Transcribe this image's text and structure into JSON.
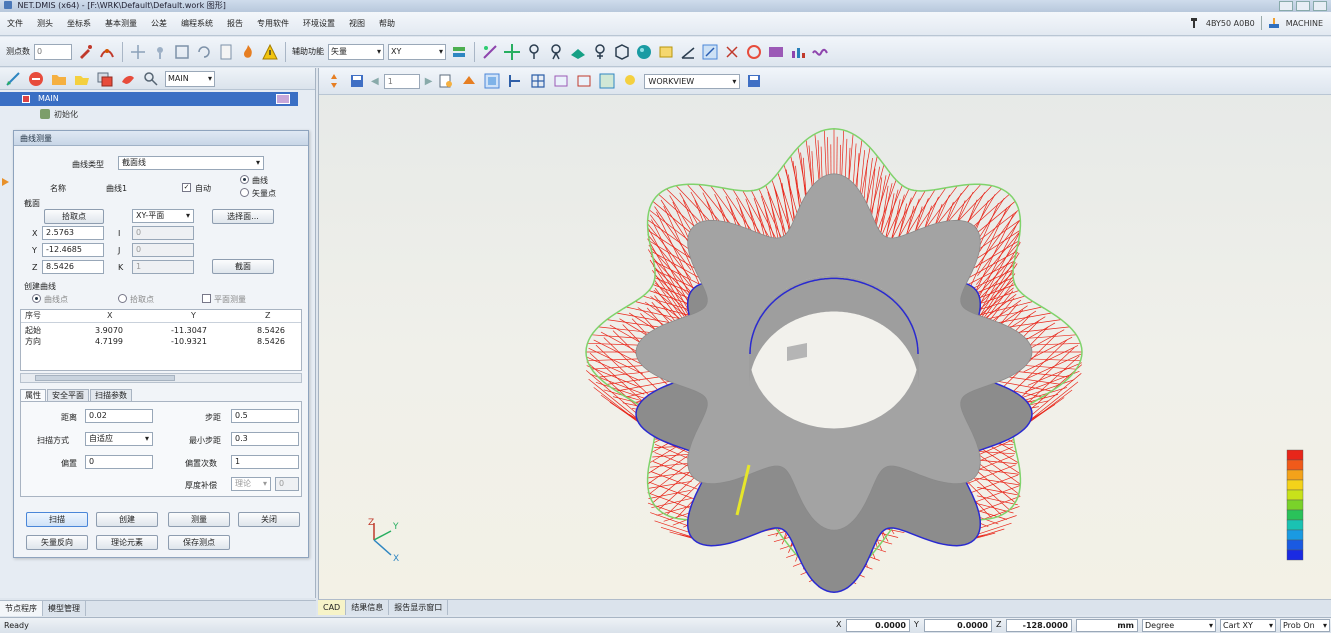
{
  "window": {
    "title": "NET.DMIS (x64) - [F:\\WRK\\Default\\Default.work 图形]"
  },
  "menu": {
    "items": [
      "文件",
      "测头",
      "坐标系",
      "基本测量",
      "公差",
      "编程系统",
      "报告",
      "专用软件",
      "环境设置",
      "视图",
      "帮助"
    ],
    "right_probe": "4BY50  A0B0",
    "right_machine": "MACHINE"
  },
  "toolbar": {
    "probe_label": "测点数",
    "probe_value": "0",
    "aux_label": "辅助功能",
    "aux_value": "矢量",
    "plane_value": "XY"
  },
  "left": {
    "program_combo": "MAIN",
    "tree_main": "MAIN",
    "tree_child": "初始化"
  },
  "dialog": {
    "title": "曲线测量",
    "curve_type_label": "曲线类型",
    "curve_type_value": "截面线",
    "name_label": "名称",
    "name_value": "曲线1",
    "auto_label": "自动",
    "radio_curve": "曲线",
    "radio_vector": "矢量点",
    "section_label": "截面",
    "pick_point_btn": "拾取点",
    "plane_combo": "XY-平面",
    "select_plane_btn": "选择面...",
    "x_label": "X",
    "x_value": "2.5763",
    "y_label": "Y",
    "y_value": "-12.4685",
    "z_label": "Z",
    "z_value": "8.5426",
    "i_label": "I",
    "i_value": "0",
    "j_label": "J",
    "j_value": "0",
    "k_label": "K",
    "k_value": "1",
    "section_btn": "截面",
    "create_curve_label": "创建曲线",
    "opt_curve_point": "曲线点",
    "opt_pick_point": "拾取点",
    "opt_parallel": "平面测量",
    "table": {
      "headers": [
        "序号",
        "X",
        "Y",
        "Z"
      ],
      "rows": [
        [
          "起始",
          "3.9070",
          "-11.3047",
          "8.5426"
        ],
        [
          "方向",
          "4.7199",
          "-10.9321",
          "8.5426"
        ]
      ]
    },
    "tabs": [
      "属性",
      "安全平面",
      "扫描参数"
    ],
    "props": {
      "spacing_label": "距离",
      "spacing_value": "0.02",
      "step_label": "步距",
      "step_value": "0.5",
      "scan_mode_label": "扫描方式",
      "scan_mode_value": "自适应",
      "min_step_label": "最小步距",
      "min_step_value": "0.3",
      "offset_label": "偏置",
      "offset_value": "0",
      "max_step_label": "偏置次数",
      "max_step_value": "1",
      "thickness_label": "厚度补偿",
      "thickness_combo": "理论",
      "thickness_value": "0"
    },
    "buttons": {
      "scan": "扫描",
      "create": "创建",
      "measure": "测量",
      "close": "关闭",
      "vector_reverse": "矢量反向",
      "theory_element": "理论元素",
      "save_points": "保存测点"
    }
  },
  "left_bottom_tabs": [
    "节点程序",
    "模型管理"
  ],
  "viewport": {
    "page_value": "1",
    "view_combo": "WORKVIEW",
    "tabs": [
      "CAD",
      "结果信息",
      "报告显示窗口"
    ],
    "axis_x": "X",
    "axis_y": "Y",
    "axis_z": "Z"
  },
  "colors": {
    "accent": "#3a6fc4",
    "part": "#a3a3a3",
    "vectors": "#e8261a",
    "scan_path": "#2a2ad0",
    "outline": "#7fd36b"
  },
  "status": {
    "ready": "Ready",
    "x_label": "X",
    "x_value": "0.0000",
    "y_label": "Y",
    "y_value": "0.0000",
    "z_label": "Z",
    "z_value": "-128.0000",
    "unit": "mm",
    "angle_unit": "Degree",
    "coord": "Cart XY",
    "probe_on": "Prob On"
  }
}
